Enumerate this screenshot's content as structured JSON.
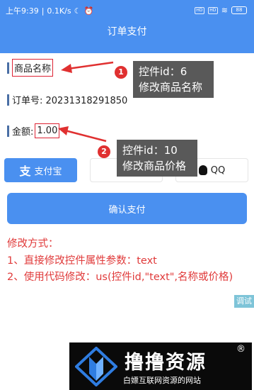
{
  "status": {
    "time": "上午9:39",
    "speed": "0.1K/s",
    "battery": "88"
  },
  "header": {
    "title": "订单支付"
  },
  "fields": {
    "name_label": "商品名称",
    "order_label": "订单号: 20231318291850",
    "amount_label": "金额:",
    "amount_value": "1.00"
  },
  "annotations": [
    {
      "number": "1",
      "line1": "控件id：6",
      "line2": "修改商品名称"
    },
    {
      "number": "2",
      "line1": "控件id：10",
      "line2": "修改商品价格"
    }
  ],
  "payments": {
    "alipay": "支付宝",
    "qq": "QQ"
  },
  "confirm_label": "确认支付",
  "notes": [
    "修改方式：",
    "1、直接修改控件属性参数：text",
    "2、使用代码修改：us(控件id,\"text\",名称或价格)"
  ],
  "debug_label": "调试",
  "watermark": {
    "title": "撸撸资源",
    "subtitle": "白嫖互联网资源的网站",
    "mark": "®"
  },
  "colors": {
    "accent": "#4a90f0",
    "annotation_red": "#e03030",
    "tooltip": "#595959"
  }
}
